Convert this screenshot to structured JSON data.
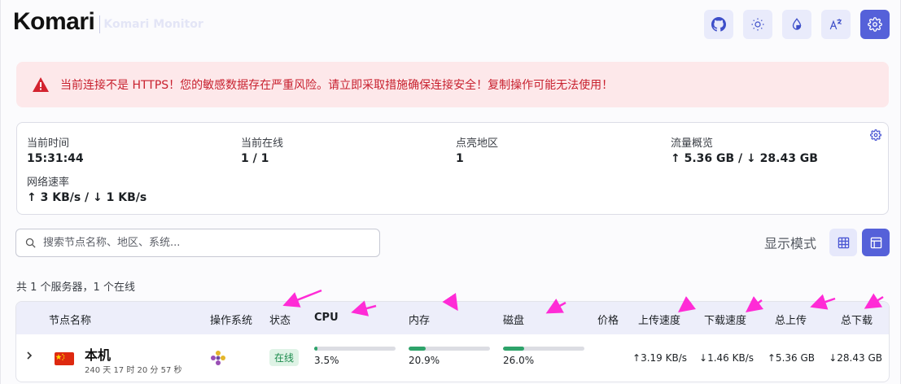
{
  "header": {
    "brand": "Komari",
    "subtitle": "Komari Monitor",
    "actions": [
      {
        "icon": "github-icon"
      },
      {
        "icon": "sun-icon"
      },
      {
        "icon": "droplet-icon"
      },
      {
        "icon": "translate-icon"
      },
      {
        "icon": "settings-icon"
      }
    ]
  },
  "alert": {
    "text": "当前连接不是 HTTPS！您的敏感数据存在严重风险。请立即采取措施确保连接安全！复制操作可能无法使用！",
    "color": "#c8202e"
  },
  "stats": {
    "current_time": {
      "label": "当前时间",
      "value": "15:31:44"
    },
    "online": {
      "label": "当前在线",
      "value": "1 / 1"
    },
    "regions": {
      "label": "点亮地区",
      "value": "1"
    },
    "traffic": {
      "label": "流量概览",
      "value": "↑ 5.36 GB / ↓ 28.43 GB"
    },
    "speed": {
      "label": "网络速率",
      "value": "↑ 3 KB/s / ↓ 1 KB/s"
    }
  },
  "search": {
    "placeholder": "搜索节点名称、地区、系统..."
  },
  "display_mode": {
    "label": "显示模式",
    "options": [
      "grid",
      "table"
    ],
    "selected": "table"
  },
  "summary": "共 1 个服务器，1 个在线",
  "table": {
    "headers": {
      "name": "节点名称",
      "os": "操作系统",
      "status": "状态",
      "cpu": "CPU",
      "mem": "内存",
      "disk": "磁盘",
      "price": "价格",
      "up_speed": "上传速度",
      "down_speed": "下载速度",
      "total_up": "总上传",
      "total_down": "总下载"
    },
    "rows": [
      {
        "name": "本机",
        "uptime": "240 天 17 时 20 分 57 秒",
        "flag": "CN",
        "status": "在线",
        "cpu": "3.5%",
        "cpu_value": 3.5,
        "mem": "20.9%",
        "mem_value": 20.9,
        "disk": "26.0%",
        "disk_value": 26.0,
        "up_speed": "↑3.19 KB/s",
        "down_speed": "↓1.46 KB/s",
        "total_up": "↑5.36 GB",
        "total_down": "↓28.43 GB"
      }
    ]
  },
  "colors": {
    "accent": "#5561d9",
    "online_green": "#2ea36a",
    "annotation": "#ff2bd6"
  }
}
